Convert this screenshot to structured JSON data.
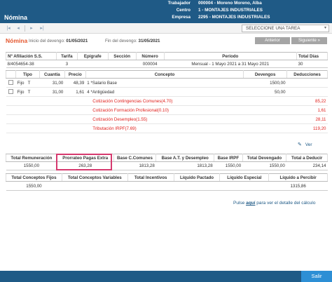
{
  "app": {
    "title": "Nómina"
  },
  "header_info": [
    {
      "label": "Trabajador",
      "value": "000004 - Moreno Moreno, Alba"
    },
    {
      "label": "Centro",
      "value": "1 - MONTAJES INDUSTRIALES"
    },
    {
      "label": "Empresa",
      "value": "2295 - MONTAJES INDUSTRIALES"
    }
  ],
  "toolbar": {
    "nav_icons": [
      "first-icon",
      "previous-icon",
      "next-icon",
      "last-icon"
    ],
    "task_select": "SELECCIONE UNA TAREA"
  },
  "subheader": {
    "title": "Nómina",
    "start_label": "Inicio del devengo:",
    "start_value": "01/05/2021",
    "end_label": "Fin del devengo:",
    "end_value": "31/05/2021",
    "prev_button": "Anterior",
    "next_button": "Siguiente"
  },
  "affiliation": {
    "headers": [
      "Nº Afiliación S.S.",
      "Tarifa",
      "Epígrafe",
      "Sección",
      "Número",
      "Período",
      "Total Días"
    ],
    "row": [
      "8/4054654-38",
      "3",
      "",
      "",
      "000004",
      "Mensual - 1 Mayo 2021 a 31 Mayo 2021",
      "30"
    ]
  },
  "concepts": {
    "headers": [
      "",
      "Tipo",
      "Cuantía",
      "Precio",
      "Concepto",
      "Devengos",
      "Deducciones"
    ],
    "rows": [
      {
        "tipo": "Fijo",
        "tipo_flag": "T",
        "cuantia": "31,00",
        "precio": "48,39",
        "num": "1",
        "concepto": "*Salario Base",
        "devengos": "1500,00",
        "deducciones": ""
      },
      {
        "tipo": "Fijo",
        "tipo_flag": "T",
        "cuantia": "31,00",
        "precio": "1,61",
        "num": "4",
        "concepto": "*Antigüedad",
        "devengos": "50,00",
        "deducciones": ""
      }
    ],
    "deductions": [
      {
        "concepto": "Cotización Contingencias Comunes(4.70)",
        "value": "85,22"
      },
      {
        "concepto": "Cotización Formación Profesional(0.10)",
        "value": "1,61"
      },
      {
        "concepto": "Cotización Desempleo(1.55)",
        "value": "28,11"
      },
      {
        "concepto": "Tributación IRPF(7.69)",
        "value": "119,20"
      }
    ]
  },
  "ver_link": "Ver",
  "totals1": {
    "headers": [
      "Total Remuneración",
      "Prorrateo Pagas Extra",
      "Base C.Comunes",
      "Base A.T. y Desempleo",
      "Base IRPF",
      "Total Devengado",
      "Total a Deducir"
    ],
    "values": [
      "1550,00",
      "263,28",
      "1813,28",
      "1813,28",
      "1550,00",
      "1550,00",
      "234,14"
    ]
  },
  "totals2": {
    "headers": [
      "Total Conceptos Fijos",
      "Total Conceptos Variables",
      "Total Incentivos",
      "Líquido Pactado",
      "Líquido Especial",
      "Líquido a Percibir"
    ],
    "values": [
      "1550,00",
      "",
      "",
      "",
      "",
      "1315,86"
    ]
  },
  "detail_link": {
    "prefix": "Pulse",
    "here": "aquí",
    "suffix": "para ver el detalle del cálculo"
  },
  "footer": {
    "exit_button": "Salir"
  },
  "colors": {
    "header_bg": "#1f5a86",
    "title_accent": "#e4572e",
    "deduction_red": "#e0201c",
    "highlight": "#d63a6f",
    "exit_button": "#2d8fd5"
  }
}
